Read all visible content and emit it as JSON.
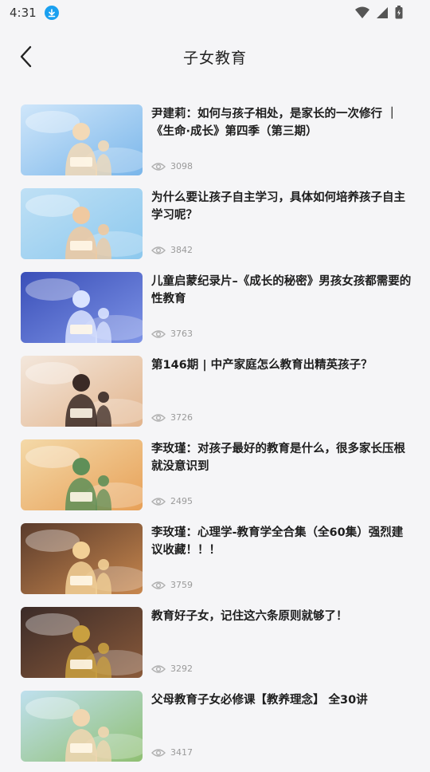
{
  "status": {
    "time": "4:31"
  },
  "header": {
    "title": "子女教育"
  },
  "items": [
    {
      "title": "尹建莉：如何与孩子相处，是家长的一次修行 ｜《生命·成长》第四季（第三期）",
      "views": "3098",
      "colors": [
        "#cfe6fa",
        "#7ab6ea",
        "#f3d9b6"
      ]
    },
    {
      "title": "为什么要让孩子自主学习，具体如何培养孩子自主学习呢？",
      "views": "3842",
      "colors": [
        "#bfe0f5",
        "#8cc8ee",
        "#f0c9a0"
      ]
    },
    {
      "title": "儿童启蒙纪录片–《成长的秘密》男孩女孩都需要的性教育",
      "views": "3763",
      "colors": [
        "#3a4fb8",
        "#7d93e6",
        "#d9e3ff"
      ]
    },
    {
      "title": "第146期 | 中产家庭怎么教育出精英孩子？",
      "views": "3726",
      "colors": [
        "#f3e7dc",
        "#e2b48c",
        "#3a2a26"
      ]
    },
    {
      "title": "李玫瑾：对孩子最好的教育是什么，很多家长压根就没意识到",
      "views": "2495",
      "colors": [
        "#f4d9a8",
        "#e7a057",
        "#5f8f58"
      ]
    },
    {
      "title": "李玫瑾：心理学-教育学全合集（全60集）强烈建议收藏！！！",
      "views": "3759",
      "colors": [
        "#5a3b2c",
        "#c8874d",
        "#f2d096"
      ]
    },
    {
      "title": "教育好子女，记住这六条原则就够了！",
      "views": "3292",
      "colors": [
        "#3b2b28",
        "#8a5a3a",
        "#c9a040"
      ]
    },
    {
      "title": "父母教育子女必修课【教养理念】 全30讲",
      "views": "3417",
      "colors": [
        "#bfe0ee",
        "#8fbf72",
        "#f1d6b0"
      ]
    }
  ]
}
